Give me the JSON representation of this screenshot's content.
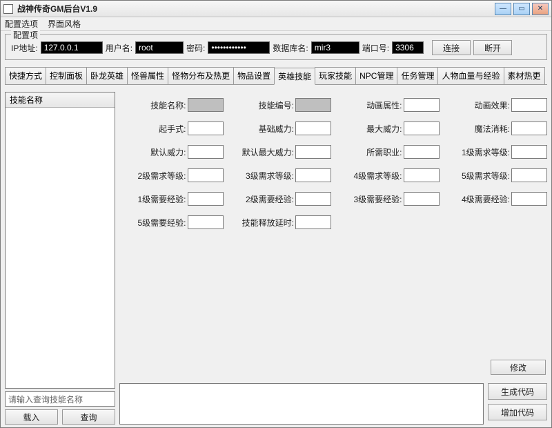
{
  "window": {
    "title": "战神传奇GM后台V1.9"
  },
  "menu": [
    "配置选项",
    "界面风格"
  ],
  "config": {
    "legend": "配置项",
    "ip_label": "IP地址:",
    "ip": "127.0.0.1",
    "user_label": "用户名:",
    "user": "root",
    "pass_label": "密码:",
    "pass": "************",
    "db_label": "数据库名:",
    "db": "mir3",
    "port_label": "端口号:",
    "port": "3306",
    "connect": "连接",
    "disconnect": "断开"
  },
  "tabs": [
    "快捷方式",
    "控制面板",
    "卧龙英雄",
    "怪兽属性",
    "怪物分布及热更",
    "物品设置",
    "英雄技能",
    "玩家技能",
    "NPC管理",
    "任务管理",
    "人物血量与经验",
    "素材热更"
  ],
  "left": {
    "list_header": "技能名称",
    "search_placeholder": "请输入查询技能名称",
    "load": "载入",
    "query": "查询"
  },
  "form": [
    "技能名称:",
    "技能编号:",
    "动画属性:",
    "动画效果:",
    "起手式:",
    "基础威力:",
    "最大威力:",
    "魔法消耗:",
    "默认威力:",
    "默认最大威力:",
    "所需职业:",
    "1级需求等级:",
    "2级需求等级:",
    "3级需求等级:",
    "4级需求等级:",
    "5级需求等级:",
    "1级需要经验:",
    "2级需要经验:",
    "3级需要经验:",
    "4级需要经验:",
    "5级需要经验:",
    "技能释放延时:"
  ],
  "right": {
    "modify": "修改",
    "gen_code": "生成代码",
    "add_code": "增加代码"
  }
}
